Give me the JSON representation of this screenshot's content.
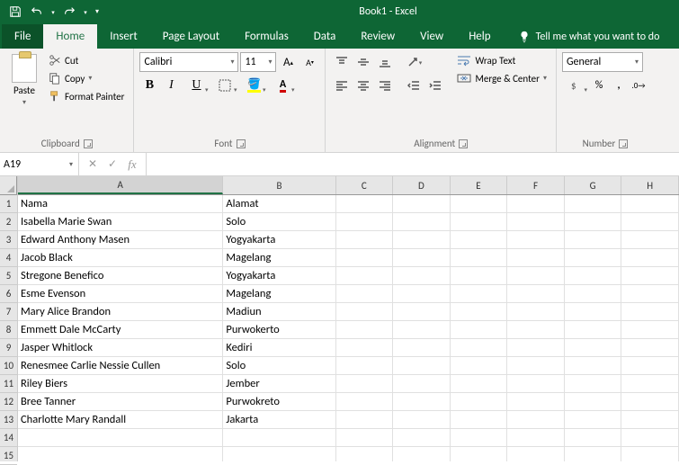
{
  "titlebar": {
    "title": "Book1  -  Excel"
  },
  "menu": {
    "file": "File",
    "home": "Home",
    "insert": "Insert",
    "page_layout": "Page Layout",
    "formulas": "Formulas",
    "data": "Data",
    "review": "Review",
    "view": "View",
    "help": "Help",
    "tellme": "Tell me what you want to do"
  },
  "ribbon": {
    "clipboard": {
      "label": "Clipboard",
      "paste": "Paste",
      "cut": "Cut",
      "copy": "Copy",
      "format_painter": "Format Painter"
    },
    "font": {
      "label": "Font",
      "name": "Calibri",
      "size": "11"
    },
    "alignment": {
      "label": "Alignment",
      "wrap": "Wrap Text",
      "merge": "Merge & Center"
    },
    "number": {
      "label": "Number",
      "format": "General"
    }
  },
  "fbar": {
    "namebox": "A19",
    "formula": ""
  },
  "columns": [
    "A",
    "B",
    "C",
    "D",
    "E",
    "F",
    "G",
    "H"
  ],
  "chart_data": {
    "type": "table",
    "columns": [
      "Nama",
      "Alamat"
    ],
    "rows": [
      [
        "Isabella Marie Swan",
        "Solo"
      ],
      [
        "Edward Anthony Masen",
        "Yogyakarta"
      ],
      [
        "Jacob Black",
        "Magelang"
      ],
      [
        "Stregone Benefico",
        "Yogyakarta"
      ],
      [
        "Esme Evenson",
        "Magelang"
      ],
      [
        "Mary Alice Brandon",
        "Madiun"
      ],
      [
        "Emmett Dale McCarty",
        "Purwokerto"
      ],
      [
        "Jasper Whitlock",
        "Kediri"
      ],
      [
        "Renesmee Carlie Nessie Cullen",
        "Solo"
      ],
      [
        "Riley Biers",
        "Jember"
      ],
      [
        "Bree Tanner",
        "Purwokreto"
      ],
      [
        " Charlotte  Mary Randall",
        "Jakarta"
      ]
    ]
  },
  "row_count": 15
}
